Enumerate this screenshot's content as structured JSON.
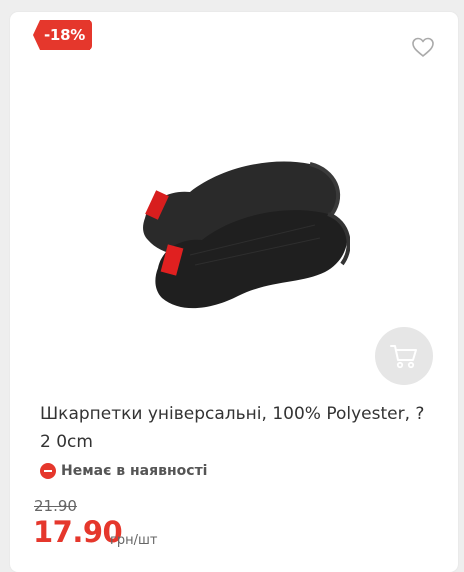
{
  "product": {
    "discount_badge": "-18%",
    "title": "Шкарпетки універсальні, 100% Polyester, ? 2 0cm",
    "availability": "Немає в наявності",
    "old_price": "21.90",
    "price": "17.90",
    "unit": "грн/шт"
  },
  "icons": {
    "favorite": "heart-outline-icon",
    "cart": "shopping-cart-icon",
    "availability": "minus-circle-icon"
  },
  "colors": {
    "accent": "#e5372c",
    "cart_button_bg": "#e6e6e6",
    "card_bg": "#ffffff"
  }
}
